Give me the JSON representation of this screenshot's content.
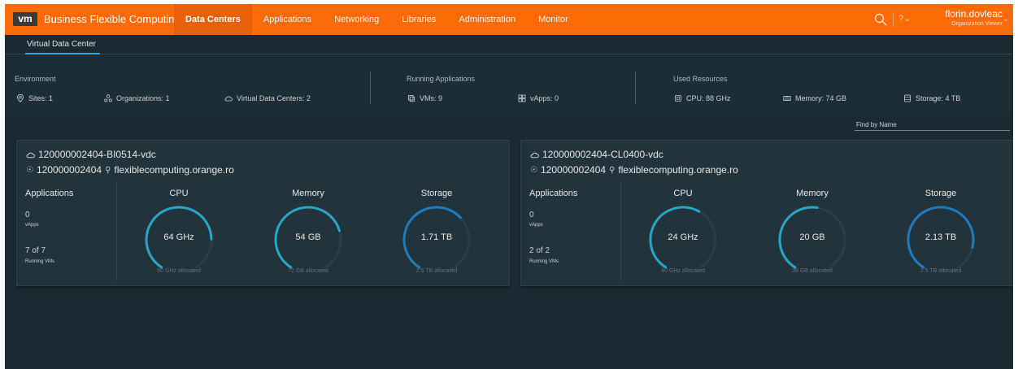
{
  "header": {
    "logo": "vm",
    "brand": "Business Flexible Computing",
    "nav": [
      "Data Centers",
      "Applications",
      "Networking",
      "Libraries",
      "Administration",
      "Monitor"
    ],
    "active_nav": "Data Centers",
    "help": "?⌄",
    "user_name": "florin.dovleac",
    "user_role": "Organization Viewer",
    "accent_color": "#fd6a08"
  },
  "subnav": {
    "tab": "Virtual Data Center"
  },
  "summary": {
    "environment": {
      "title": "Environment",
      "sites": "Sites: 1",
      "organizations": "Organizations: 1",
      "vdcs": "Virtual Data Centers: 2"
    },
    "running": {
      "title": "Running Applications",
      "vms": "VMs: 9",
      "vapps": "vApps: 0"
    },
    "resources": {
      "title": "Used Resources",
      "cpu": "CPU: 88 GHz",
      "memory": "Memory: 74 GB",
      "storage": "Storage: 4 TB"
    }
  },
  "find": {
    "placeholder": "Find by Name"
  },
  "vdcs": [
    {
      "name": "120000002404-BI0514-vdc",
      "org": "120000002404",
      "site": "flexiblecomputing.orange.ro",
      "applications": {
        "title": "Applications",
        "vapps_count": "0",
        "vapps_label": "vApps",
        "vms_count": "7 of 7",
        "vms_label": "Running VMs"
      },
      "cpu": {
        "title": "CPU",
        "value": "64 GHz",
        "allocated": "80 GHz allocated",
        "fraction": 0.8
      },
      "memory": {
        "title": "Memory",
        "value": "54 GB",
        "allocated": "72 GB allocated",
        "fraction": 0.75
      },
      "storage": {
        "title": "Storage",
        "value": "1.71 TB",
        "allocated": "2.6 TB allocated",
        "fraction": 0.66
      }
    },
    {
      "name": "120000002404-CL0400-vdc",
      "org": "120000002404",
      "site": "flexiblecomputing.orange.ro",
      "applications": {
        "title": "Applications",
        "vapps_count": "0",
        "vapps_label": "vApps",
        "vms_count": "2 of 2",
        "vms_label": "Running VMs"
      },
      "cpu": {
        "title": "CPU",
        "value": "24 GHz",
        "allocated": "40 GHz allocated",
        "fraction": 0.6
      },
      "memory": {
        "title": "Memory",
        "value": "20 GB",
        "allocated": "38 GB allocated",
        "fraction": 0.53
      },
      "storage": {
        "title": "Storage",
        "value": "2.13 TB",
        "allocated": "2.5 TB allocated",
        "fraction": 0.85
      }
    }
  ],
  "colors": {
    "cpu_gauge": "#27a6c9",
    "memory_gauge": "#27a6c9",
    "storage_gauge": "#1d7cbf",
    "gauge_track": "#2c3d47"
  }
}
